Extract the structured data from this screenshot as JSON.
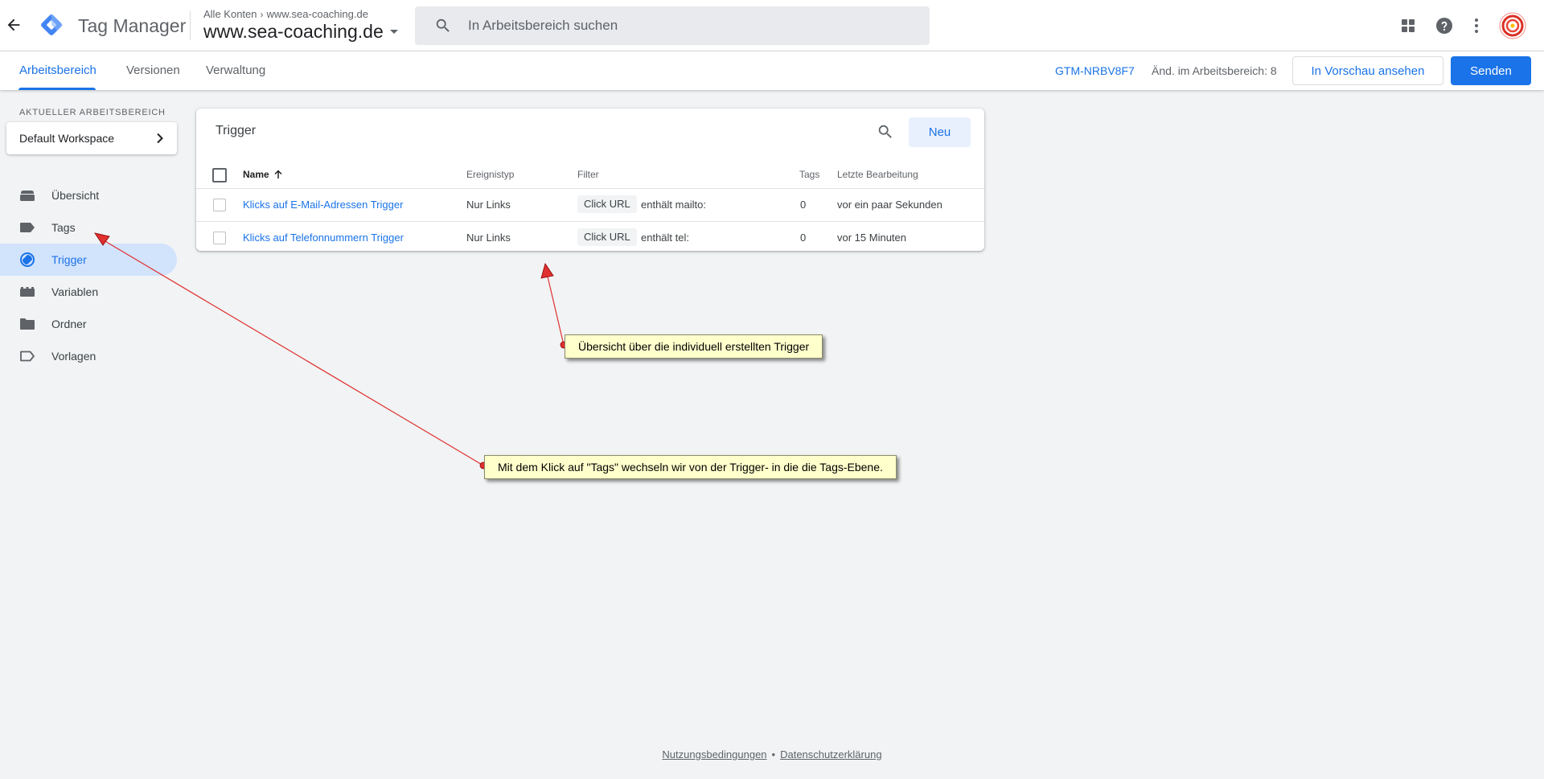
{
  "app": {
    "product_name": "Tag Manager",
    "breadcrumb_root": "Alle Konten",
    "breadcrumb_account": "www.sea-coaching.de",
    "container_name": "www.sea-coaching.de",
    "search_placeholder": "In Arbeitsbereich suchen"
  },
  "tabs": {
    "workspace": "Arbeitsbereich",
    "versions": "Versionen",
    "admin": "Verwaltung"
  },
  "header_right": {
    "container_id": "GTM-NRBV8F7",
    "changes": "Änd. im Arbeitsbereich: 8",
    "preview_label": "In Vorschau ansehen",
    "submit_label": "Senden"
  },
  "sidebar": {
    "workspace_label": "AKTUELLER ARBEITSBEREICH",
    "workspace_name": "Default Workspace",
    "items": [
      {
        "label": "Übersicht",
        "icon": "briefcase-icon"
      },
      {
        "label": "Tags",
        "icon": "tag-icon"
      },
      {
        "label": "Trigger",
        "icon": "trigger-icon"
      },
      {
        "label": "Variablen",
        "icon": "variables-icon"
      },
      {
        "label": "Ordner",
        "icon": "folder-icon"
      },
      {
        "label": "Vorlagen",
        "icon": "template-icon"
      }
    ],
    "active_item": "Trigger"
  },
  "trigger_table": {
    "title": "Trigger",
    "new_label": "Neu",
    "columns": {
      "name": "Name",
      "event_type": "Ereignistyp",
      "filter": "Filter",
      "tags": "Tags",
      "last_edited": "Letzte Bearbeitung"
    },
    "rows": [
      {
        "name": "Klicks auf E-Mail-Adressen Trigger",
        "event_type": "Nur Links",
        "filter_variable": "Click URL",
        "filter_condition": "enthält mailto:",
        "tags": "0",
        "last_edited": "vor ein paar Sekunden"
      },
      {
        "name": "Klicks auf Telefonnummern Trigger",
        "event_type": "Nur Links",
        "filter_variable": "Click URL",
        "filter_condition": "enthält tel:",
        "tags": "0",
        "last_edited": "vor 15 Minuten"
      }
    ]
  },
  "annotations": {
    "overview_note": "Übersicht über die individuell erstellten Trigger",
    "tags_note": "Mit dem Klick auf \"Tags\" wechseln wir von der Trigger- in die die Tags-Ebene."
  },
  "footer": {
    "terms": "Nutzungsbedingungen",
    "separator": "•",
    "privacy": "Datenschutzerklärung"
  },
  "colors": {
    "accent": "#1a73e8",
    "active_nav_bg": "#d2e3fc",
    "annotation_arrow": "#e03030",
    "callout_bg": "#ffffcc"
  }
}
